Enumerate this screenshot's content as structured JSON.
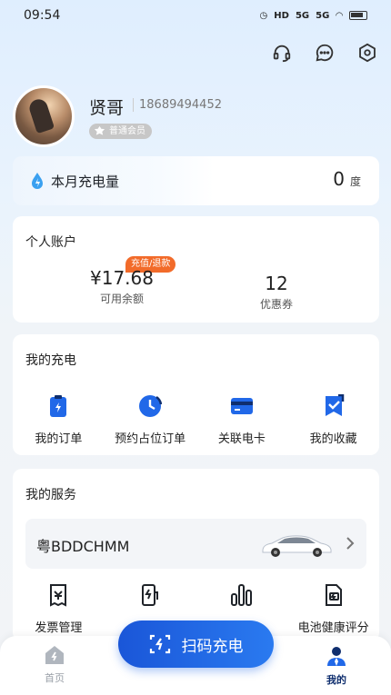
{
  "status": {
    "time": "09:54",
    "net1": "HD",
    "net2": "5G",
    "net3": "5G"
  },
  "profile": {
    "name": "贤哥",
    "phone": "18689494452",
    "level": "普通会员"
  },
  "energy": {
    "label": "本月充电量",
    "value": "0",
    "unit": "度"
  },
  "account": {
    "title": "个人账户",
    "balance": "¥17.68",
    "balance_label": "可用余额",
    "recharge": "充值/退款",
    "coupons": "12",
    "coupons_label": "优惠券"
  },
  "charge": {
    "title": "我的充电",
    "items": [
      {
        "label": "我的订单",
        "icon": "clipboard-icon"
      },
      {
        "label": "预约占位订单",
        "icon": "clock-icon"
      },
      {
        "label": "关联电卡",
        "icon": "card-icon"
      },
      {
        "label": "我的收藏",
        "icon": "bookmark-icon"
      }
    ]
  },
  "services": {
    "title": "我的服务",
    "plate": "粤BDDCHMM",
    "items": [
      {
        "label": "发票管理",
        "icon": "invoice-icon"
      },
      {
        "label": "",
        "icon": "charger-icon"
      },
      {
        "label": "",
        "icon": "stats-icon"
      },
      {
        "label": "电池健康评分",
        "icon": "battery-health-icon"
      }
    ]
  },
  "scan": {
    "label": "扫码充电"
  },
  "tabs": {
    "home": "首页",
    "mine": "我的"
  },
  "colors": {
    "accent": "#2168e8",
    "badge_orange": "#f26b2a"
  }
}
